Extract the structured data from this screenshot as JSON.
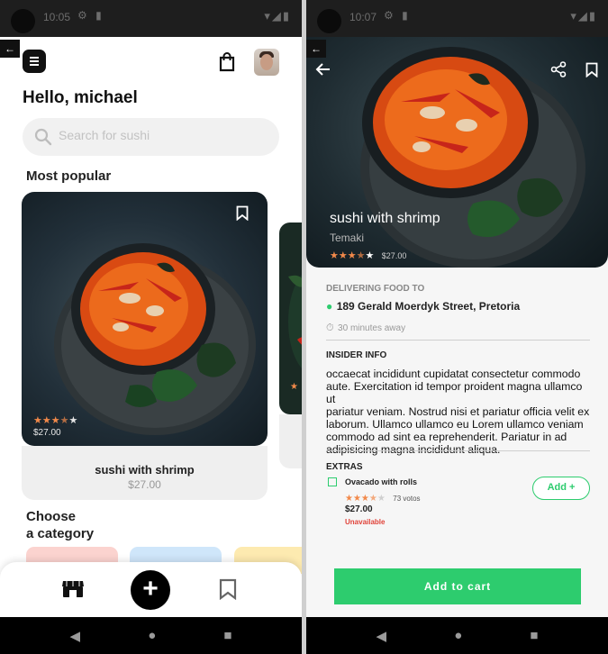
{
  "left": {
    "status": {
      "time": "10:05"
    },
    "greeting": "Hello, michael",
    "search": {
      "placeholder": "Search for sushi"
    },
    "most_popular_title": "Most popular",
    "featured": {
      "name": "sushi with shrimp",
      "price": "$27.00",
      "rating": 3.5,
      "image_price": "$27.00"
    },
    "category_title_line1": "Choose",
    "category_title_line2": "a category",
    "category_chip_colors": [
      "#fbd3cf",
      "#cfe6fa",
      "#fdeab0"
    ],
    "bottom_nav": {
      "icons": [
        "store-icon",
        "add-icon",
        "bookmark-icon"
      ],
      "fab_label": "+"
    }
  },
  "right": {
    "status": {
      "time": "10:07"
    },
    "hero": {
      "title": "sushi with shrimp",
      "subtitle": "Temaki",
      "rating": 3.5,
      "price": "$27.00"
    },
    "delivery": {
      "label": "DELIVERING FOOD TO",
      "address": "189 Gerald Moerdyk Street, Pretoria",
      "eta": "30 minutes away"
    },
    "insider": {
      "label": "INSIDER INFO",
      "lines": [
        "occaecat incididunt cupidatat consectetur commodo",
        "aute. Exercitation id tempor proident magna ullamco ut",
        "pariatur veniam. Nostrud nisi et pariatur officia velit ex",
        "laborum. Ullamco ullamco eu Lorem ullamco veniam",
        "commodo ad sint ea reprehenderit. Pariatur in ad",
        "adipisicing magna incididunt aliqua."
      ]
    },
    "extras": {
      "label": "EXTRAS",
      "item": {
        "name": "Ovacado with rolls",
        "rating": 3.5,
        "votes": "73 votos",
        "price": "$27.00",
        "availability": "Unavailable",
        "add_label": "Add +"
      }
    },
    "cart_button": "Add to cart"
  },
  "colors": {
    "accent_green": "#2dcc6e",
    "star": "#f2894a",
    "unavailable": "#e0433a"
  }
}
